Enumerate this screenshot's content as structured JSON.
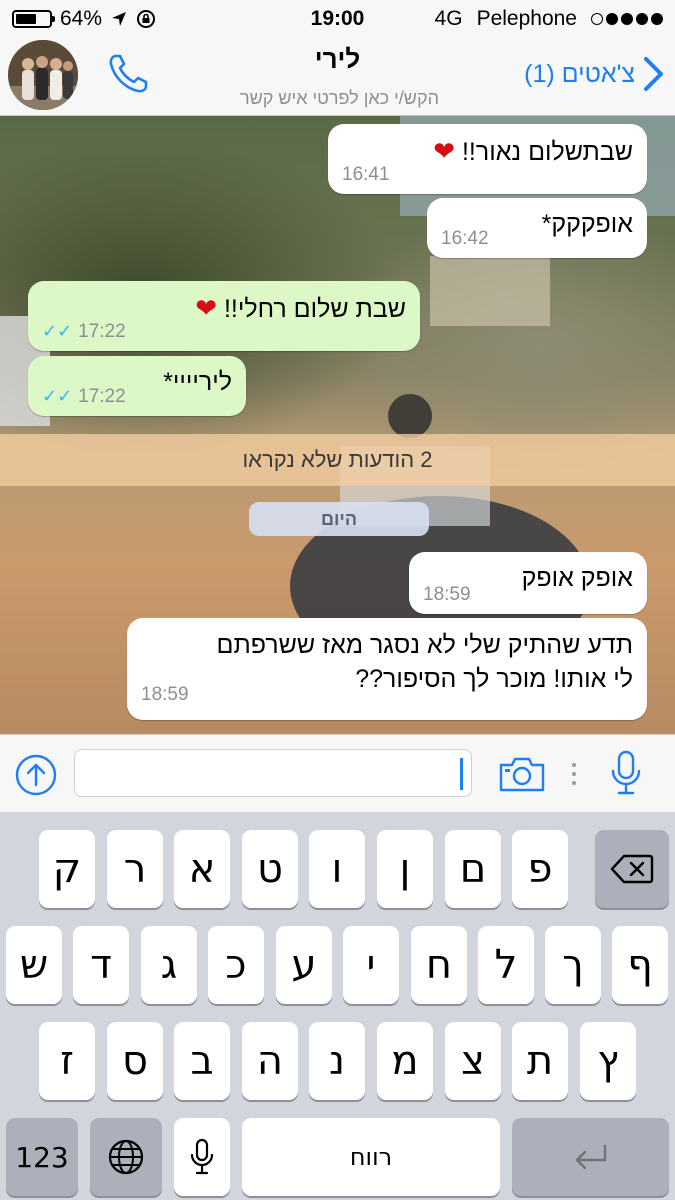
{
  "status_bar": {
    "battery_percent_label": "64%",
    "battery_level": 0.64,
    "time": "19:00",
    "network": "4G",
    "carrier": "Pelephone"
  },
  "header": {
    "back_label": "צ'אטים (1)",
    "contact_name": "לירי",
    "subtitle": "הקש/י כאן לפרטי איש קשר"
  },
  "messages": [
    {
      "direction": "in",
      "text": "שבתשלום נאור!!",
      "emoji": "heart",
      "time": "16:41"
    },
    {
      "direction": "in",
      "text": "אופקקק*",
      "time": "16:42"
    },
    {
      "direction": "out",
      "text": "שבת שלום רחלי!!",
      "emoji": "heart",
      "time": "17:22",
      "status": "read"
    },
    {
      "direction": "out",
      "text": "ליריייי*",
      "time": "17:22",
      "status": "read"
    },
    {
      "direction": "in",
      "text": "אופק אופק",
      "time": "18:59"
    },
    {
      "direction": "in",
      "text_line1": "תדע שהתיק שלי לא נסגר מאז ששרפתם",
      "text_line2": "לי אותו! מוכר לך הסיפור??",
      "time": "18:59"
    }
  ],
  "unread_banner": "2 הודעות שלא נקראו",
  "date_separator": "היום",
  "input": {
    "value": "",
    "placeholder": ""
  },
  "keyboard": {
    "row1": [
      "פ",
      "ם",
      "ן",
      "ו",
      "ט",
      "א",
      "ר",
      "ק"
    ],
    "row2": [
      "ף",
      "ך",
      "ל",
      "ח",
      "י",
      "ע",
      "כ",
      "ג",
      "ד",
      "ש"
    ],
    "row3": [
      "ץ",
      "ת",
      "צ",
      "מ",
      "נ",
      "ה",
      "ב",
      "ס",
      "ז"
    ],
    "numbers_label": "123",
    "space_label": "רווח"
  },
  "colors": {
    "accent": "#1e7ef4",
    "outgoing_bubble": "#dcf8c6",
    "incoming_bubble": "#ffffff",
    "read_ticks": "#34b7f1",
    "unread_banner": "#f3cda0"
  }
}
